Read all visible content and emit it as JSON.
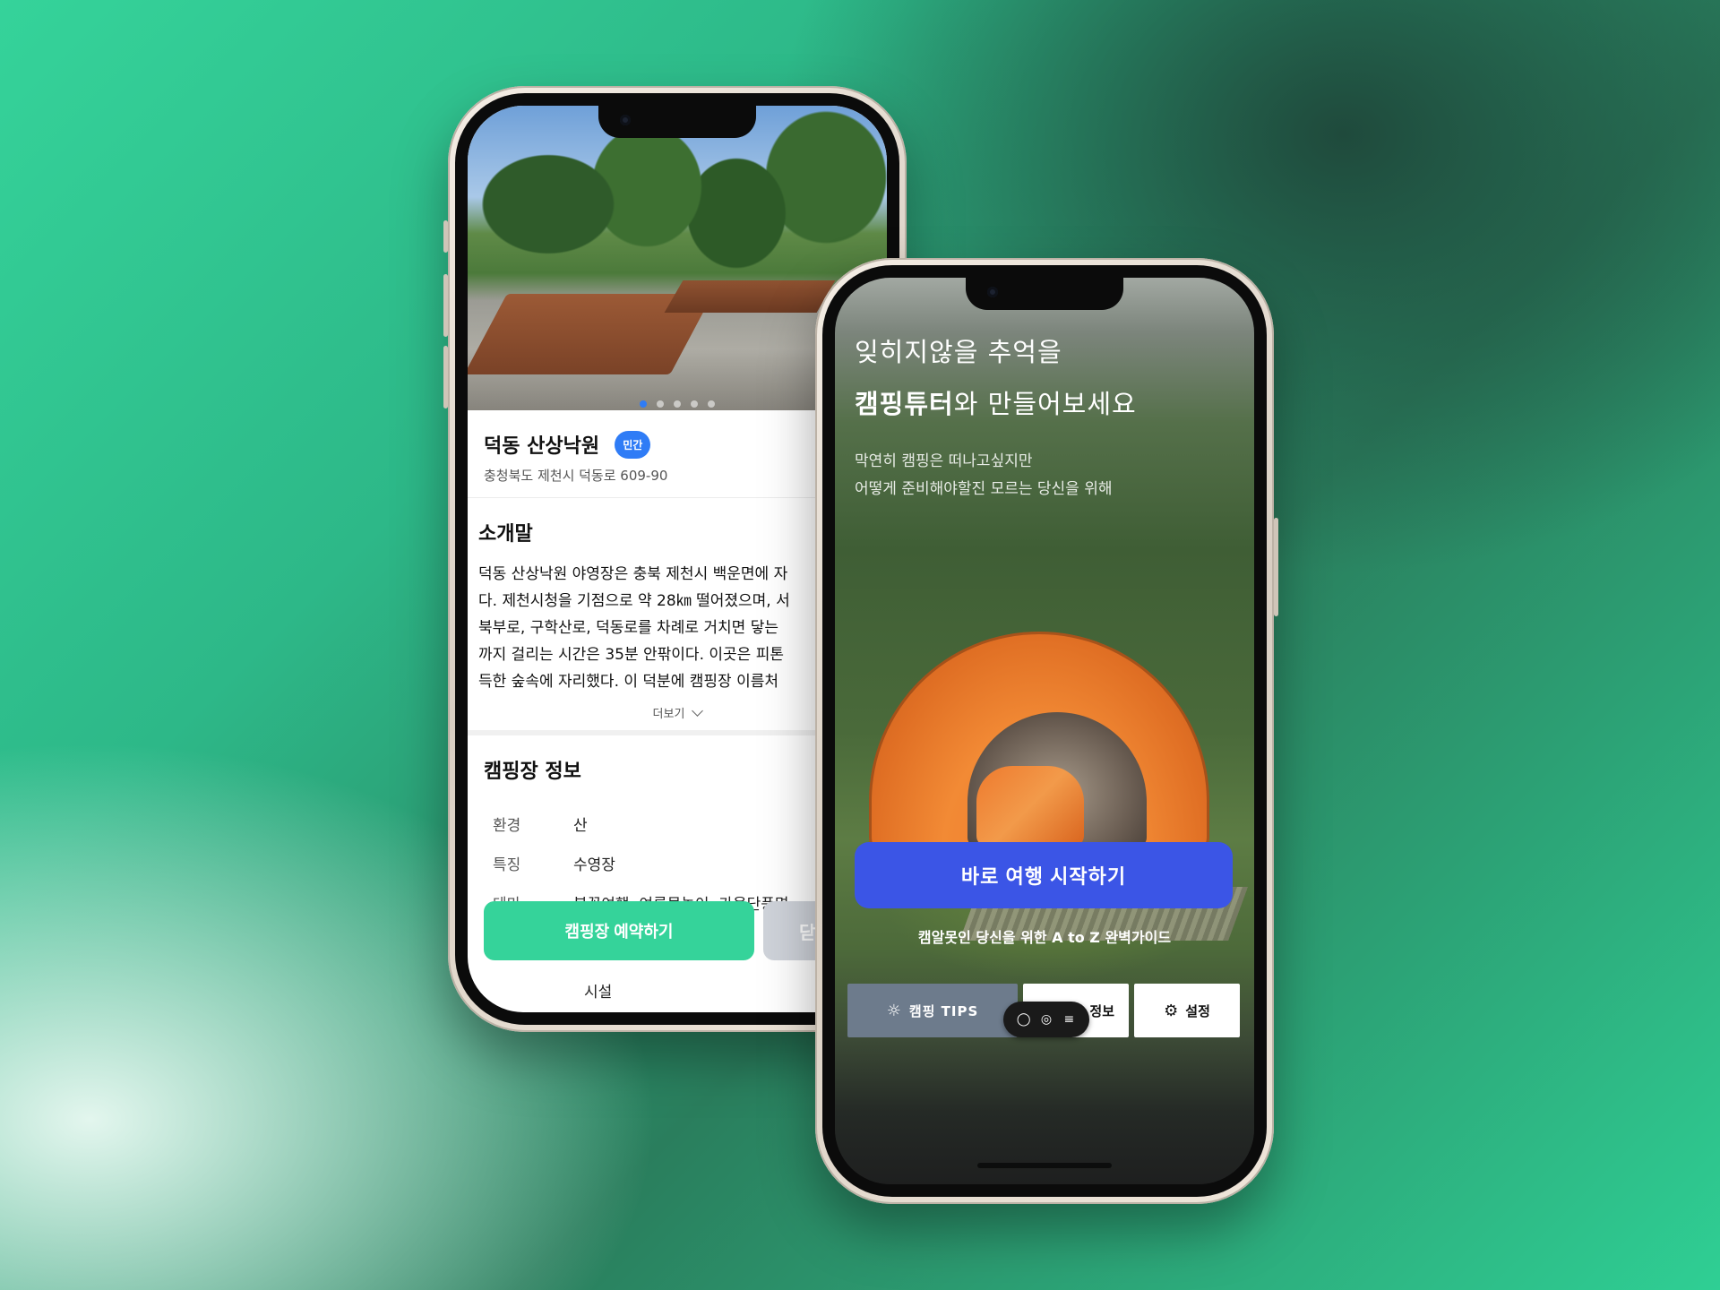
{
  "left_phone": {
    "camp": {
      "name": "덕동 산상낙원",
      "badge": "민간",
      "address": "충청북도 제천시 덕동로 609-90"
    },
    "intro": {
      "title": "소개말",
      "lines": [
        "덕동 산상낙원 야영장은 충북 제천시 백운면에 자",
        "다. 제천시청을 기점으로 약 28㎞ 떨어졌으며, 서",
        "북부로, 구학산로, 덕동로를 차례로 거치면 닿는",
        "까지 걸리는 시간은 35분 안팎이다. 이곳은 피톤",
        "득한 숲속에 자리했다. 이 덕분에 캠핑장 이름처"
      ],
      "more": "더보기"
    },
    "info": {
      "title": "캠핑장 정보",
      "rows": [
        {
          "key": "환경",
          "value": "산"
        },
        {
          "key": "특징",
          "value": "수영장"
        },
        {
          "key": "테마",
          "value": "봄꽃여행, 여름물놀이, 가을단풍명"
        }
      ]
    },
    "actions": {
      "reserve": "캠핑장 예약하기",
      "secondary": "닫"
    },
    "bottom_text": "시설",
    "partial_text": "시"
  },
  "right_phone": {
    "headline_line1": "잊히지않을 추억을",
    "headline_brand": "캠핑튜터",
    "headline_rest": "와 만들어보세요",
    "subtitle_line1": "막연히 캠핑은 떠나고싶지만",
    "subtitle_line2": "어떻게 준비해야할진 모르는 당신을 위해",
    "start_button": "바로 여행 시작하기",
    "guide": "캠알못인 당신을 위한 A to Z 완벽가이드",
    "tabs": {
      "tips": "캠핑 TIPS",
      "info": "정보",
      "settings": "설정"
    },
    "icons": {
      "tips": "lightbulb-icon",
      "settings": "gear-icon",
      "pill": [
        "chat-icon",
        "eye-icon",
        "menu-icon"
      ]
    }
  },
  "colors": {
    "accent_green": "#35d39a",
    "primary_blue": "#3b55e6",
    "badge_blue": "#2f7cf6",
    "tips_gray": "#6d7b8c"
  }
}
